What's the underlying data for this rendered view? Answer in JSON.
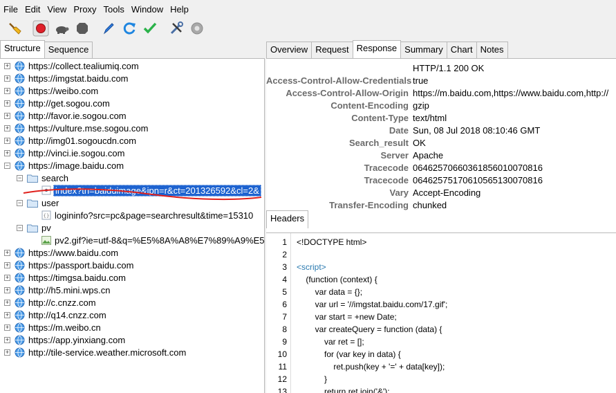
{
  "menu": [
    "File",
    "Edit",
    "View",
    "Proxy",
    "Tools",
    "Window",
    "Help"
  ],
  "toolbar": {
    "icons": [
      "broom-icon",
      "record-icon",
      "turtle-icon",
      "stop-icon",
      "pen-icon",
      "refresh-icon",
      "checkmark-icon",
      "tools-icon",
      "settings-icon"
    ]
  },
  "left_tabs": [
    "Structure",
    "Sequence"
  ],
  "tree": {
    "hosts_top": [
      "https://collect.tealiumiq.com",
      "https://imgstat.baidu.com",
      "https://weibo.com",
      "http://get.sogou.com",
      "http://favor.ie.sogou.com",
      "https://vulture.mse.sogou.com",
      "http://img01.sogoucdn.com",
      "http://vinci.ie.sogou.com"
    ],
    "expanded_host": "https://image.baidu.com",
    "folder_search": "search",
    "search_file": "index?tn=baiduimage&ipn=r&ct=201326592&cl=2&",
    "folder_user": "user",
    "user_file": "logininfo?src=pc&page=searchresult&time=15310",
    "folder_pv": "pv",
    "pv_file": "pv2.gif?ie=utf-8&q=%E5%8A%A8%E7%89%A9%E5%",
    "hosts_bottom": [
      "https://www.baidu.com",
      "https://passport.baidu.com",
      "https://timgsa.baidu.com",
      "http://h5.mini.wps.cn",
      "http://c.cnzz.com",
      "http://q14.cnzz.com",
      "https://m.weibo.cn",
      "https://app.yinxiang.com",
      "http://tile-service.weather.microsoft.com"
    ]
  },
  "right_tabs": [
    "Overview",
    "Request",
    "Response",
    "Summary",
    "Chart",
    "Notes"
  ],
  "response": {
    "status_line": "HTTP/1.1 200 OK",
    "headers": [
      {
        "k": "Access-Control-Allow-Credentials",
        "v": "true"
      },
      {
        "k": "Access-Control-Allow-Origin",
        "v": "https://m.baidu.com,https://www.baidu.com,http://"
      },
      {
        "k": "Content-Encoding",
        "v": "gzip"
      },
      {
        "k": "Content-Type",
        "v": "text/html"
      },
      {
        "k": "Date",
        "v": "Sun, 08 Jul 2018 08:10:46 GMT"
      },
      {
        "k": "Search_result",
        "v": "OK"
      },
      {
        "k": "Server",
        "v": "Apache"
      },
      {
        "k": "Tracecode",
        "v": "06462570660361856010070816"
      },
      {
        "k": "Tracecode",
        "v": "06462575170610565130070816"
      },
      {
        "k": "Vary",
        "v": "Accept-Encoding"
      },
      {
        "k": "Transfer-Encoding",
        "v": "chunked"
      }
    ]
  },
  "headers_tab": "Headers",
  "code": {
    "line_numbers": [
      "1",
      "2",
      "3",
      "4",
      "5",
      "6",
      "7",
      "8",
      "9",
      "10",
      "11",
      "12",
      "13"
    ],
    "lines": [
      "<!DOCTYPE html>",
      "",
      "<script>",
      "    (function (context) {",
      "        var data = {};",
      "        var url = '//imgstat.baidu.com/17.gif';",
      "        var start = +new Date;",
      "        var createQuery = function (data) {",
      "            var ret = [];",
      "            for (var key in data) {",
      "                ret.push(key + '=' + data[key]);",
      "            }",
      "            return ret.join('&');"
    ]
  },
  "colors": {
    "selection": "#1e63d0",
    "header_key": "#6b6b6b",
    "tag": "#2a7ab0",
    "annotation_line": "#e0201c"
  }
}
